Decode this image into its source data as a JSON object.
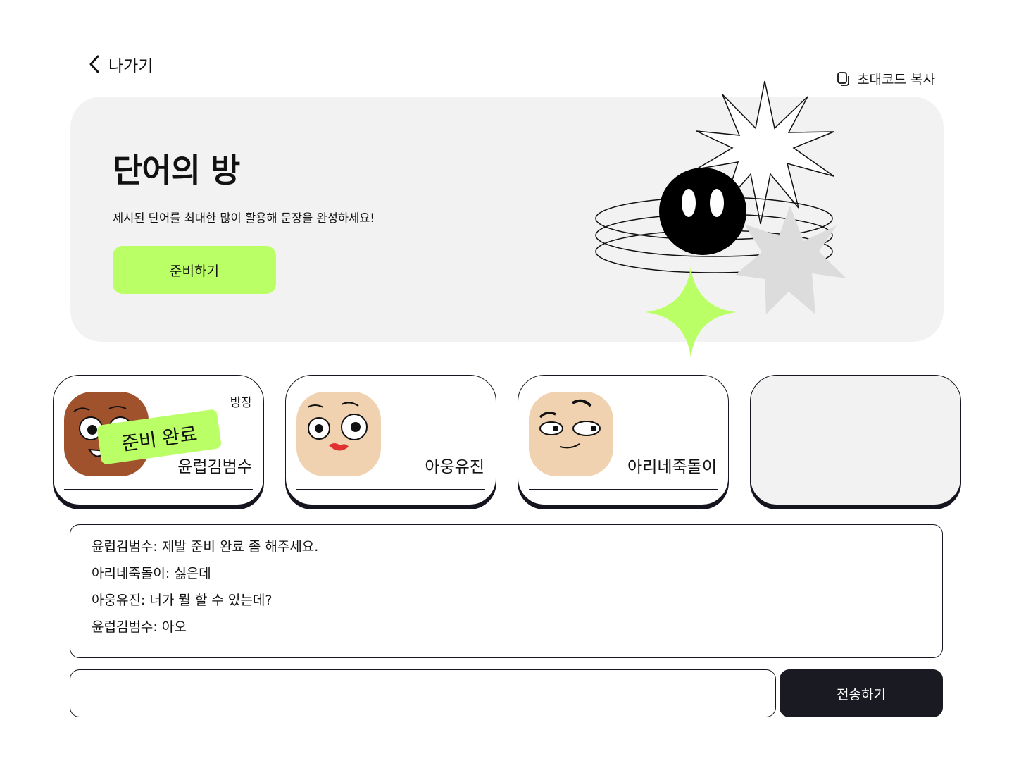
{
  "header": {
    "back_label": "나가기",
    "invite_label": "초대코드 복사"
  },
  "hero": {
    "title": "단어의 방",
    "description": "제시된 단어를 최대한 많이 활용해 문장을 완성하세요!",
    "ready_button": "준비하기"
  },
  "players": [
    {
      "name": "윤럽김범수",
      "role": "방장",
      "badge": "준비 완료",
      "avatar": "brown-face-avatar",
      "color": "#a0522d"
    },
    {
      "name": "아웅유진",
      "avatar": "beige-face-lipstick-avatar",
      "color": "#f0d2b0"
    },
    {
      "name": "아리네죽돌이",
      "avatar": "beige-face-smirk-avatar",
      "color": "#f0d2b0"
    },
    {
      "name": ""
    }
  ],
  "chat": {
    "messages": [
      "윤럽김범수: 제발 준비 완료 좀 해주세요.",
      "아리네죽돌이: 싫은데",
      "아웅유진: 너가 뭘 할 수 있는데?",
      "윤럽김범수: 아오"
    ]
  },
  "composer": {
    "input_value": "",
    "send_label": "전송하기"
  },
  "colors": {
    "accent": "#bbff66",
    "dark": "#1a1a22",
    "panel": "#f2f2f2"
  }
}
